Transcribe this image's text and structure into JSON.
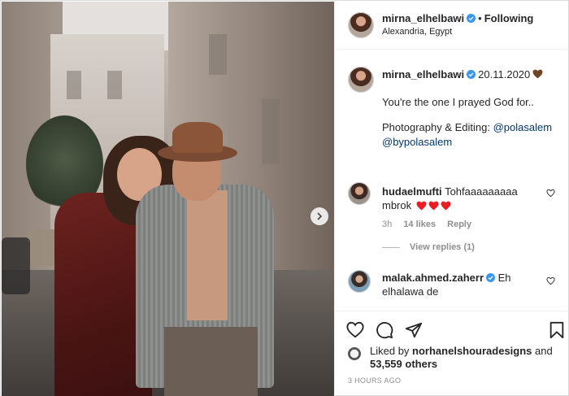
{
  "post": {
    "image_alt_people": "photo",
    "next_icon": "chevron-right-icon"
  },
  "header": {
    "username": "mirna_elhelbawi",
    "separator": "•",
    "follow_status": "Following",
    "location": "Alexandria, Egypt"
  },
  "caption": {
    "username": "mirna_elhelbawi",
    "date": "20.11.2020",
    "line1": "You're the one I prayed God for..",
    "credit_prefix": "Photography & Editing:",
    "credit_link1": "@polasalem",
    "credit_link2": "@bypolasalem"
  },
  "comments": [
    {
      "username": "hudaelmufti",
      "text": "Tohfaaaaaaaaa mbrok",
      "age": "3h",
      "likes": "14 likes",
      "reply": "Reply",
      "view_replies": "View replies (1)"
    },
    {
      "username": "malak.ahmed.zaherr",
      "text": "Eh elhalawa de"
    }
  ],
  "footer": {
    "liked_by_prefix": "Liked by",
    "liked_by_user": "norhanelshouradesigns",
    "liked_by_and": "and",
    "likes_count": "53,559 others",
    "timestamp": "3 hours ago"
  },
  "colors": {
    "verified": "#3897f0",
    "link": "#00376b",
    "heart_red": "#ed1c24",
    "heart_brown": "#6f4326",
    "muted": "#8e8e8e"
  }
}
